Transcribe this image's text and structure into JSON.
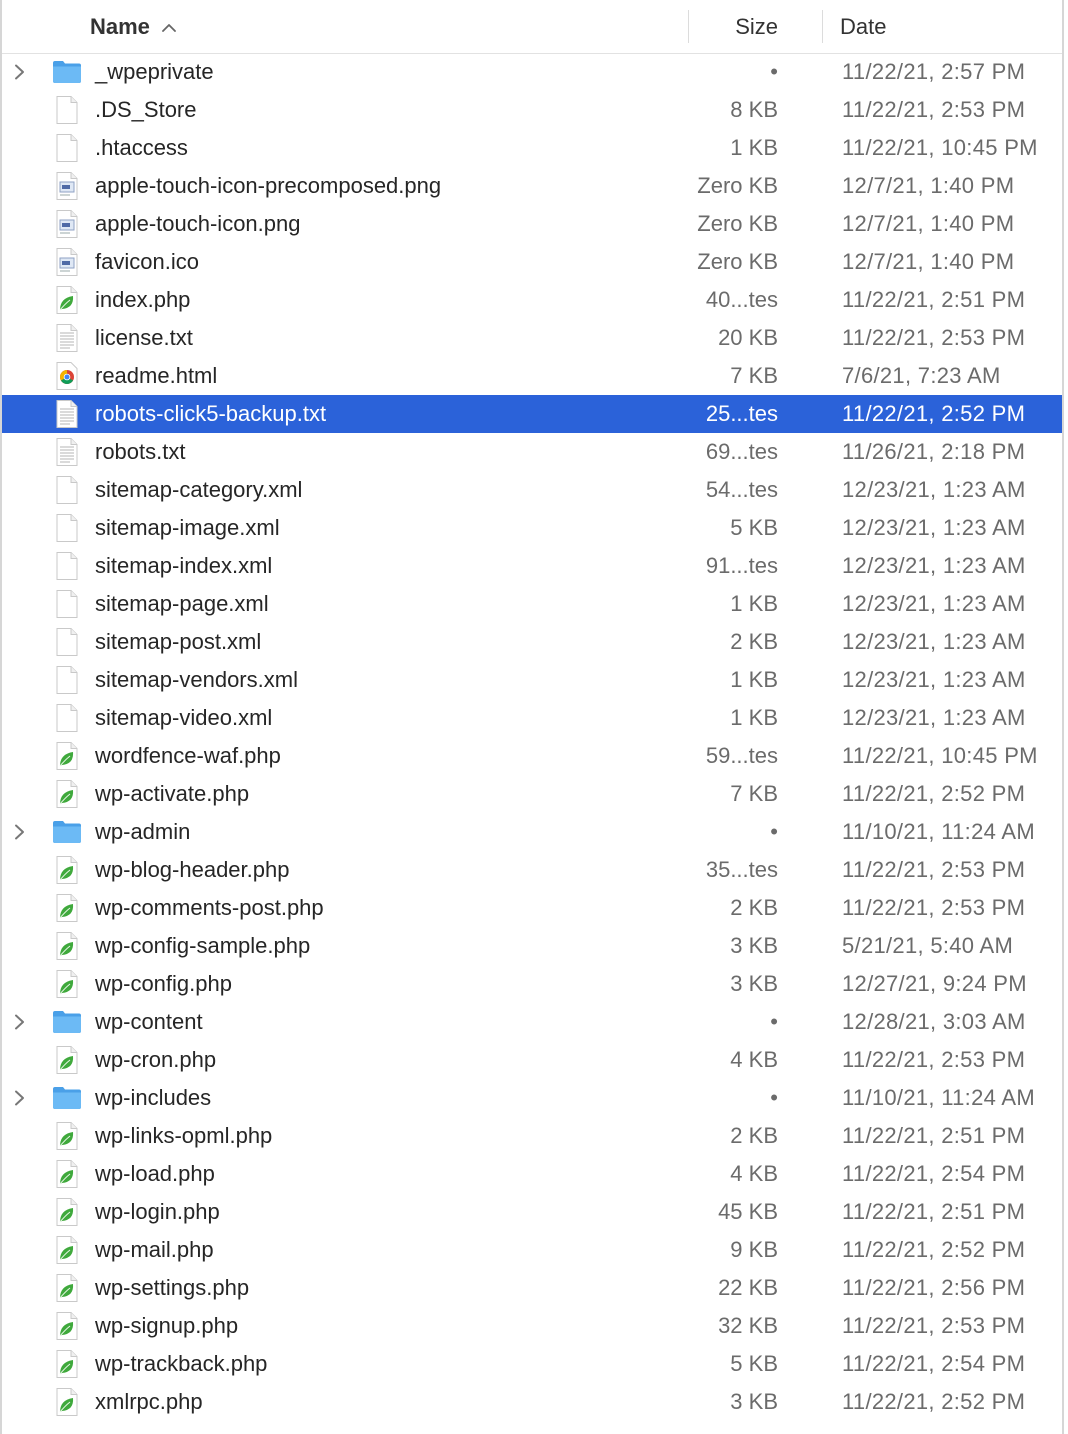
{
  "header": {
    "name_label": "Name",
    "size_label": "Size",
    "date_label": "Date",
    "sort_indicator": "chevron-up-icon"
  },
  "colors": {
    "selection": "#2b62d9",
    "folder": "#5aaef0",
    "php_leaf": "#3fa93c"
  },
  "selected_index": 9,
  "rows": [
    {
      "name": "_wpeprivate",
      "size": "•",
      "date": "11/22/21, 2:57 PM",
      "kind": "folder"
    },
    {
      "name": ".DS_Store",
      "size": "8 KB",
      "date": "11/22/21, 2:53 PM",
      "kind": "blank"
    },
    {
      "name": ".htaccess",
      "size": "1 KB",
      "date": "11/22/21, 10:45 PM",
      "kind": "blank"
    },
    {
      "name": "apple-touch-icon-precomposed.png",
      "size": "Zero KB",
      "date": "12/7/21, 1:40 PM",
      "kind": "image"
    },
    {
      "name": "apple-touch-icon.png",
      "size": "Zero KB",
      "date": "12/7/21, 1:40 PM",
      "kind": "image"
    },
    {
      "name": "favicon.ico",
      "size": "Zero KB",
      "date": "12/7/21, 1:40 PM",
      "kind": "image"
    },
    {
      "name": "index.php",
      "size": "40...tes",
      "date": "11/22/21, 2:51 PM",
      "kind": "php"
    },
    {
      "name": "license.txt",
      "size": "20 KB",
      "date": "11/22/21, 2:53 PM",
      "kind": "text"
    },
    {
      "name": "readme.html",
      "size": "7 KB",
      "date": "7/6/21, 7:23 AM",
      "kind": "chrome"
    },
    {
      "name": "robots-click5-backup.txt",
      "size": "25...tes",
      "date": "11/22/21, 2:52 PM",
      "kind": "text"
    },
    {
      "name": "robots.txt",
      "size": "69...tes",
      "date": "11/26/21, 2:18 PM",
      "kind": "text"
    },
    {
      "name": "sitemap-category.xml",
      "size": "54...tes",
      "date": "12/23/21, 1:23 AM",
      "kind": "blank"
    },
    {
      "name": "sitemap-image.xml",
      "size": "5 KB",
      "date": "12/23/21, 1:23 AM",
      "kind": "blank"
    },
    {
      "name": "sitemap-index.xml",
      "size": "91...tes",
      "date": "12/23/21, 1:23 AM",
      "kind": "blank"
    },
    {
      "name": "sitemap-page.xml",
      "size": "1 KB",
      "date": "12/23/21, 1:23 AM",
      "kind": "blank"
    },
    {
      "name": "sitemap-post.xml",
      "size": "2 KB",
      "date": "12/23/21, 1:23 AM",
      "kind": "blank"
    },
    {
      "name": "sitemap-vendors.xml",
      "size": "1 KB",
      "date": "12/23/21, 1:23 AM",
      "kind": "blank"
    },
    {
      "name": "sitemap-video.xml",
      "size": "1 KB",
      "date": "12/23/21, 1:23 AM",
      "kind": "blank"
    },
    {
      "name": "wordfence-waf.php",
      "size": "59...tes",
      "date": "11/22/21, 10:45 PM",
      "kind": "php"
    },
    {
      "name": "wp-activate.php",
      "size": "7 KB",
      "date": "11/22/21, 2:52 PM",
      "kind": "php"
    },
    {
      "name": "wp-admin",
      "size": "•",
      "date": "11/10/21, 11:24 AM",
      "kind": "folder"
    },
    {
      "name": "wp-blog-header.php",
      "size": "35...tes",
      "date": "11/22/21, 2:53 PM",
      "kind": "php"
    },
    {
      "name": "wp-comments-post.php",
      "size": "2 KB",
      "date": "11/22/21, 2:53 PM",
      "kind": "php"
    },
    {
      "name": "wp-config-sample.php",
      "size": "3 KB",
      "date": "5/21/21, 5:40 AM",
      "kind": "php"
    },
    {
      "name": "wp-config.php",
      "size": "3 KB",
      "date": "12/27/21, 9:24 PM",
      "kind": "php"
    },
    {
      "name": "wp-content",
      "size": "•",
      "date": "12/28/21, 3:03 AM",
      "kind": "folder"
    },
    {
      "name": "wp-cron.php",
      "size": "4 KB",
      "date": "11/22/21, 2:53 PM",
      "kind": "php"
    },
    {
      "name": "wp-includes",
      "size": "•",
      "date": "11/10/21, 11:24 AM",
      "kind": "folder"
    },
    {
      "name": "wp-links-opml.php",
      "size": "2 KB",
      "date": "11/22/21, 2:51 PM",
      "kind": "php"
    },
    {
      "name": "wp-load.php",
      "size": "4 KB",
      "date": "11/22/21, 2:54 PM",
      "kind": "php"
    },
    {
      "name": "wp-login.php",
      "size": "45 KB",
      "date": "11/22/21, 2:51 PM",
      "kind": "php"
    },
    {
      "name": "wp-mail.php",
      "size": "9 KB",
      "date": "11/22/21, 2:52 PM",
      "kind": "php"
    },
    {
      "name": "wp-settings.php",
      "size": "22 KB",
      "date": "11/22/21, 2:56 PM",
      "kind": "php"
    },
    {
      "name": "wp-signup.php",
      "size": "32 KB",
      "date": "11/22/21, 2:53 PM",
      "kind": "php"
    },
    {
      "name": "wp-trackback.php",
      "size": "5 KB",
      "date": "11/22/21, 2:54 PM",
      "kind": "php"
    },
    {
      "name": "xmlrpc.php",
      "size": "3 KB",
      "date": "11/22/21, 2:52 PM",
      "kind": "php"
    }
  ]
}
